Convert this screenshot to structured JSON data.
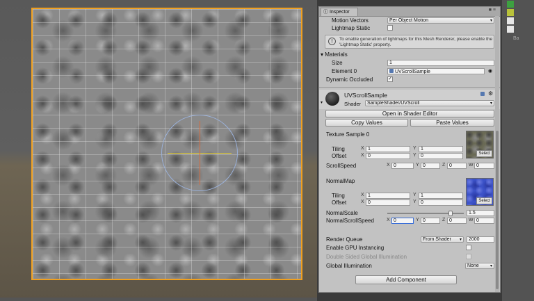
{
  "inspector": {
    "tab_title": "Inspector",
    "motion_vectors": {
      "label": "Motion Vectors",
      "value": "Per Object Motion"
    },
    "lightmap_static": {
      "label": "Lightmap Static",
      "checked": false
    },
    "help_text": "To enable generation of lightmaps for this Mesh Renderer, please enable the 'Lightmap Static' property.",
    "materials": {
      "label": "Materials",
      "size_label": "Size",
      "size_value": "1",
      "element_label": "Element 0",
      "element_value": "UVScrollSample"
    },
    "dynamic_occluded": {
      "label": "Dynamic Occluded",
      "checked": true
    },
    "material": {
      "name": "UVScrollSample",
      "shader_label": "Shader",
      "shader_value": "SampleShader/UVScroll"
    },
    "buttons": {
      "open_shader": "Open in Shader Editor",
      "copy_values": "Copy Values",
      "paste_values": "Paste Values",
      "add_component": "Add Component"
    },
    "texture_sample": {
      "label": "Texture Sample 0",
      "tiling_label": "Tiling",
      "offset_label": "Offset",
      "tiling_x": "1",
      "tiling_y": "1",
      "offset_x": "0",
      "offset_y": "0",
      "select": "Select"
    },
    "scroll_speed": {
      "label": "ScrollSpeed",
      "x": "0",
      "y": "0",
      "z": "0",
      "w": "0"
    },
    "normal_map": {
      "label": "NormalMap",
      "tiling_label": "Tiling",
      "offset_label": "Offset",
      "tiling_x": "1",
      "tiling_y": "1",
      "offset_x": "0",
      "offset_y": "0",
      "select": "Select"
    },
    "normal_scale": {
      "label": "NormalScale",
      "value": "1.5",
      "fraction": 0.85
    },
    "normal_scroll_speed": {
      "label": "NormalScrollSpeed",
      "x": "0",
      "y": "0",
      "z": "0",
      "w": "0"
    },
    "render_queue": {
      "label": "Render Queue",
      "mode": "From Shader",
      "value": "2000"
    },
    "gpu_instancing": {
      "label": "Enable GPU Instancing",
      "checked": false
    },
    "double_sided_gi": {
      "label": "Double Sided Global Illumination",
      "checked": false
    },
    "global_illumination": {
      "label": "Global Illumination",
      "value": "None"
    },
    "axis_letters": {
      "x": "X",
      "y": "Y",
      "z": "Z",
      "w": "W"
    }
  },
  "side_strip": {
    "label": "Ba"
  },
  "colors": {
    "selection": "#f0a020",
    "gizmo": "#9ab0d8",
    "panel": "#c2c2c2"
  }
}
